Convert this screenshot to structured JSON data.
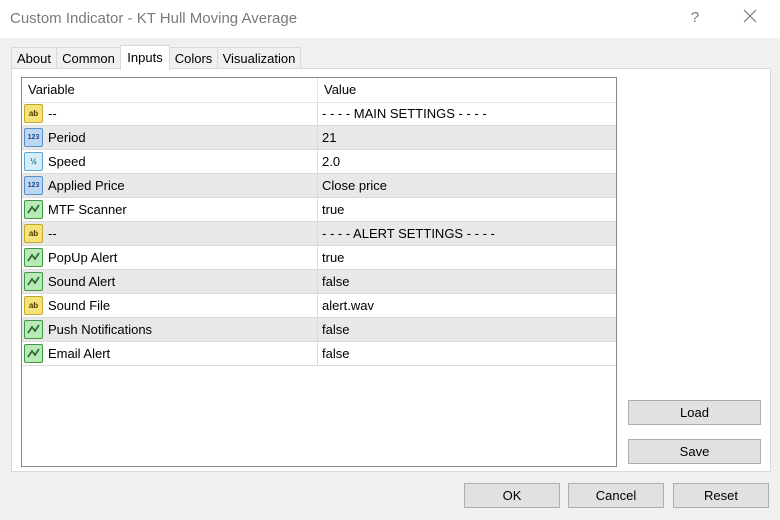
{
  "window": {
    "title": "Custom Indicator - KT Hull Moving Average",
    "help_glyph": "?"
  },
  "tabs": [
    {
      "label": "About"
    },
    {
      "label": "Common"
    },
    {
      "label": "Inputs"
    },
    {
      "label": "Colors"
    },
    {
      "label": "Visualization"
    }
  ],
  "active_tab": "Inputs",
  "grid": {
    "columns": {
      "variable": "Variable",
      "value": "Value"
    },
    "rows": [
      {
        "type": "string",
        "icon": "ab",
        "variable": "--",
        "value": "- - - - MAIN SETTINGS - - - -"
      },
      {
        "type": "integer",
        "icon": "123",
        "variable": "Period",
        "value": "21"
      },
      {
        "type": "double",
        "icon": "1/2",
        "variable": "Speed",
        "value": "2.0"
      },
      {
        "type": "integer",
        "icon": "123",
        "variable": "Applied Price",
        "value": "Close price"
      },
      {
        "type": "bool",
        "icon": "bool",
        "variable": "MTF Scanner",
        "value": "true"
      },
      {
        "type": "string",
        "icon": "ab",
        "variable": "--",
        "value": "- - - - ALERT SETTINGS - - - -"
      },
      {
        "type": "bool",
        "icon": "bool",
        "variable": "PopUp Alert",
        "value": "true"
      },
      {
        "type": "bool",
        "icon": "bool",
        "variable": "Sound Alert",
        "value": "false"
      },
      {
        "type": "string",
        "icon": "ab",
        "variable": "Sound File",
        "value": "alert.wav"
      },
      {
        "type": "bool",
        "icon": "bool",
        "variable": "Push Notifications",
        "value": "false"
      },
      {
        "type": "bool",
        "icon": "bool",
        "variable": "Email Alert",
        "value": "false"
      }
    ]
  },
  "buttons": {
    "load": "Load",
    "save": "Save",
    "ok": "OK",
    "cancel": "Cancel",
    "reset": "Reset"
  },
  "icon_text": {
    "ab": "ab",
    "int": "123",
    "dbl": "½"
  }
}
